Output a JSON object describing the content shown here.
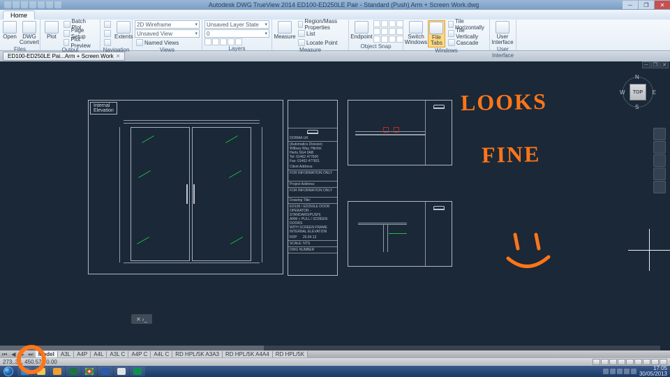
{
  "app": {
    "title": "Autodesk DWG TrueView 2014    ED100-ED250LE Pair - Standard (Push) Arm + Screen Work.dwg"
  },
  "ribbon": {
    "tab": "Home",
    "panels": {
      "files": {
        "open": "Open",
        "dwgconvert": "DWG\nConvert",
        "label": "Files"
      },
      "output": {
        "plot": "Plot",
        "batchplot": "Batch Plot",
        "pageSetup": "Page Setup",
        "plotPreview": "Plot Preview",
        "label": "Output"
      },
      "navigation": {
        "extents": "Extents",
        "label": "Navigation"
      },
      "views": {
        "wire": "2D Wireframe",
        "unsaved": "Unsaved View",
        "named": "Named Views",
        "label": "Views"
      },
      "layers": {
        "state": "Unsaved Layer State",
        "layer0": "0",
        "label": "Layers"
      },
      "measure": {
        "measure": "Measure",
        "label": "Measure",
        "region": "Region/Mass Properties",
        "list": "List",
        "locate": "Locate Point"
      },
      "osnap": {
        "endpoint": "Endpoint",
        "label": "Object Snap"
      },
      "windows": {
        "switchwin": "Switch\nWindows",
        "filetabs": "File\nTabs",
        "tileh": "Tile Horizontally",
        "tilev": "Tile Vertically",
        "cascade": "Cascade",
        "label": "Windows"
      },
      "ui": {
        "ui": "User\nInterface",
        "label": "User Interface"
      }
    }
  },
  "doctab": "ED100-ED250LE Pai...Arm + Screen Work",
  "viewcube": {
    "top": "TOP",
    "n": "N",
    "s": "S",
    "e": "E",
    "w": "W"
  },
  "drawing": {
    "label": "Internal\nElevation",
    "titleblock": {
      "company": "DORMA UK",
      "div": "(Automatics Division)",
      "addr1": "Wilbury Way, Hitchin",
      "addr2": "Herts SG4 0AB",
      "tel": "Tel: 01462 477600",
      "fax": "Fax: 01462 477601",
      "client": "Client Address:",
      "info": "FOR INFORMATION ONLY",
      "proj": "Project Address:",
      "info2": "FOR INFORMATION ONLY",
      "drawtitle": "Drawing Title:",
      "dt1": "ED100 / ED250LE DOOR",
      "dt2": "OPERATOR - STANDARD(PUSH)",
      "dt3": "ARM + PULL / SCREEN DOORS",
      "dt4": "WITH SCREEN FRAME",
      "dt5": "INTERNAL ELEVATION",
      "date": "26.04.13",
      "scale": "NTS",
      "by": "RDP",
      "dwg": "DWG NUMBER"
    }
  },
  "annotation": {
    "line1": "LOOKS",
    "line2": "FINE"
  },
  "layouts": {
    "model": "Model",
    "tabs": [
      "A3L",
      "A4P",
      "A4L",
      "A3L C",
      "A4P C",
      "A4L C",
      "RD HPL/5K A3A3",
      "RD HPL/5K A4A4",
      "RD HPL/5K"
    ]
  },
  "status": {
    "coords": "273..32, 450.57 , 0.00"
  },
  "clock": {
    "time": "17:05",
    "date": "30/05/2013"
  }
}
